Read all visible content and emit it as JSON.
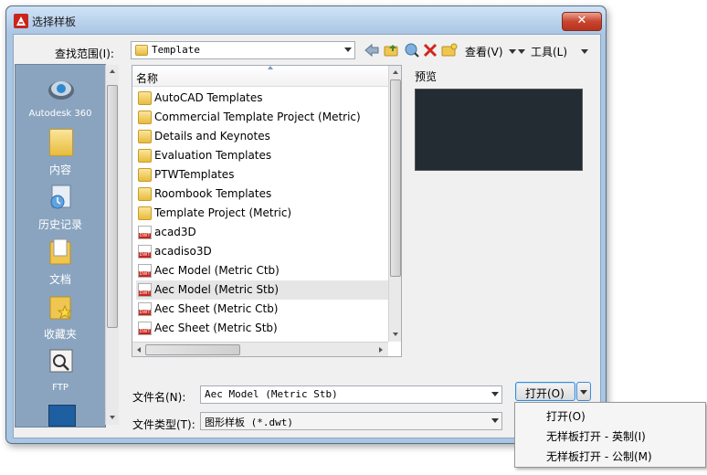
{
  "window": {
    "title": "选择样板",
    "close_glyph": "✕"
  },
  "lookin": {
    "label": "查找范围(I):",
    "value": "Template"
  },
  "toolbar": {
    "views_label": "查看(V)",
    "tools_label": "工具(L)"
  },
  "places": [
    {
      "label": "Autodesk 360",
      "icon": "cloud-icon"
    },
    {
      "label": "内容",
      "icon": "folder-icon"
    },
    {
      "label": "历史记录",
      "icon": "history-icon"
    },
    {
      "label": "文档",
      "icon": "documents-icon"
    },
    {
      "label": "收藏夹",
      "icon": "favorites-icon"
    },
    {
      "label": "FTP",
      "icon": "ftp-icon"
    }
  ],
  "filelist": {
    "column_header": "名称",
    "items": [
      {
        "name": "AutoCAD Templates",
        "type": "folder"
      },
      {
        "name": "Commercial Template Project (Metric)",
        "type": "folder"
      },
      {
        "name": "Details and Keynotes",
        "type": "folder"
      },
      {
        "name": "Evaluation Templates",
        "type": "folder"
      },
      {
        "name": "PTWTemplates",
        "type": "folder"
      },
      {
        "name": "Roombook Templates",
        "type": "folder"
      },
      {
        "name": "Template Project (Metric)",
        "type": "folder"
      },
      {
        "name": "acad3D",
        "type": "dwt"
      },
      {
        "name": "acadiso3D",
        "type": "dwt"
      },
      {
        "name": "Aec Model (Metric Ctb)",
        "type": "dwt"
      },
      {
        "name": "Aec Model (Metric Stb)",
        "type": "dwt",
        "selected": true
      },
      {
        "name": "Aec Sheet (Metric Ctb)",
        "type": "dwt"
      },
      {
        "name": "Aec Sheet (Metric Stb)",
        "type": "dwt"
      }
    ],
    "dwt_tag": "DWT"
  },
  "preview": {
    "label": "预览"
  },
  "filename": {
    "label": "文件名(N):",
    "value": "Aec Model (Metric Stb)"
  },
  "filetype": {
    "label": "文件类型(T):",
    "value": "图形样板 (*.dwt)"
  },
  "open_button": {
    "label": "打开(O)"
  },
  "open_menu": {
    "items": [
      "打开(O)",
      "无样板打开 - 英制(I)",
      "无样板打开 - 公制(M)"
    ]
  },
  "colors": {
    "accent": "#8aa4bf",
    "close": "#c9452f",
    "preview_bg": "#232b33"
  }
}
